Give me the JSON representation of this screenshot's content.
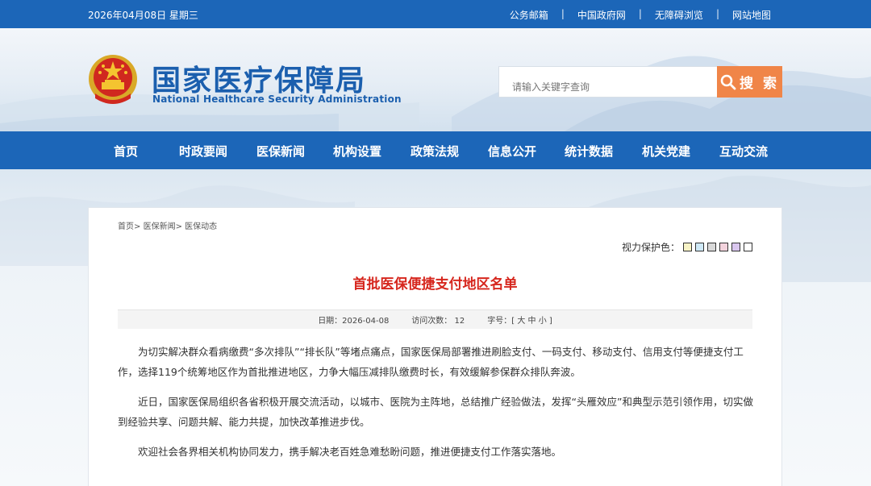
{
  "topbar": {
    "date": "2026年04月08日 星期三",
    "links": [
      "公务邮箱",
      "中国政府网",
      "无障碍浏览",
      "网站地图"
    ],
    "separator": "|"
  },
  "header": {
    "title": "国家医疗保障局",
    "subtitle": "National Healthcare Security Administration",
    "search_placeholder": "请输入关键字查询",
    "search_button": "搜 索"
  },
  "nav": {
    "items": [
      "首页",
      "时政要闻",
      "医保新闻",
      "机构设置",
      "政策法规",
      "信息公开",
      "统计数据",
      "机关党建",
      "互动交流"
    ]
  },
  "breadcrumb": [
    "首页>",
    "医保新闻>",
    "医保动态"
  ],
  "eye_protect": {
    "label": "视力保护色：",
    "colors": [
      "#f7f3c6",
      "#cfe9f7",
      "#d9d9d9",
      "#f3d3dd",
      "#d9c6ee",
      "#ffffff"
    ]
  },
  "article": {
    "title": "首批医保便捷支付地区名单",
    "date_label": "日期：2026-04-08",
    "visits_label": "访问次数：",
    "visits": "12",
    "font_label": "字号：[",
    "font_sizes": [
      "大",
      "中",
      "小"
    ],
    "font_end": "]",
    "paragraphs": [
      "为切实解决群众看病缴费“多次排队”“排长队”等堵点痛点，国家医保局部署推进刷脸支付、一码支付、移动支付、信用支付等便捷支付工作，选择119个统筹地区作为首批推进地区，力争大幅压减排队缴费时长，有效缓解参保群众排队奔波。",
      "近日，国家医保局组织各省积极开展交流活动，以城市、医院为主阵地，总结推广经验做法，发挥“头雁效应”和典型示范引领作用，切实做到经验共享、问题共解、能力共提，加快改革推进步伐。",
      "欢迎社会各界相关机构协同发力，携手解决老百姓急难愁盼问题，推进便捷支付工作落实落地。"
    ]
  },
  "colors": {
    "brand_blue": "#1c66b8",
    "title_red": "#d6261d",
    "search_orange": "#f08548"
  }
}
